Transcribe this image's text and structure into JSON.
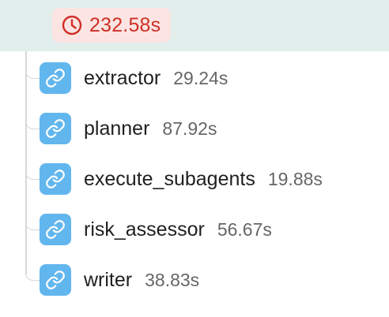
{
  "header": {
    "duration": "232.58s",
    "icon": "clock-icon",
    "color": "#cf2f26"
  },
  "nodes": [
    {
      "name": "extractor",
      "time": "29.24s",
      "icon": "link-icon"
    },
    {
      "name": "planner",
      "time": "87.92s",
      "icon": "link-icon"
    },
    {
      "name": "execute_subagents",
      "time": "19.88s",
      "icon": "link-icon"
    },
    {
      "name": "risk_assessor",
      "time": "56.67s",
      "icon": "link-icon"
    },
    {
      "name": "writer",
      "time": "38.83s",
      "icon": "link-icon"
    }
  ],
  "colors": {
    "node_icon_bg": "#62b6ee",
    "selected_row_bg": "#e1eeec"
  }
}
